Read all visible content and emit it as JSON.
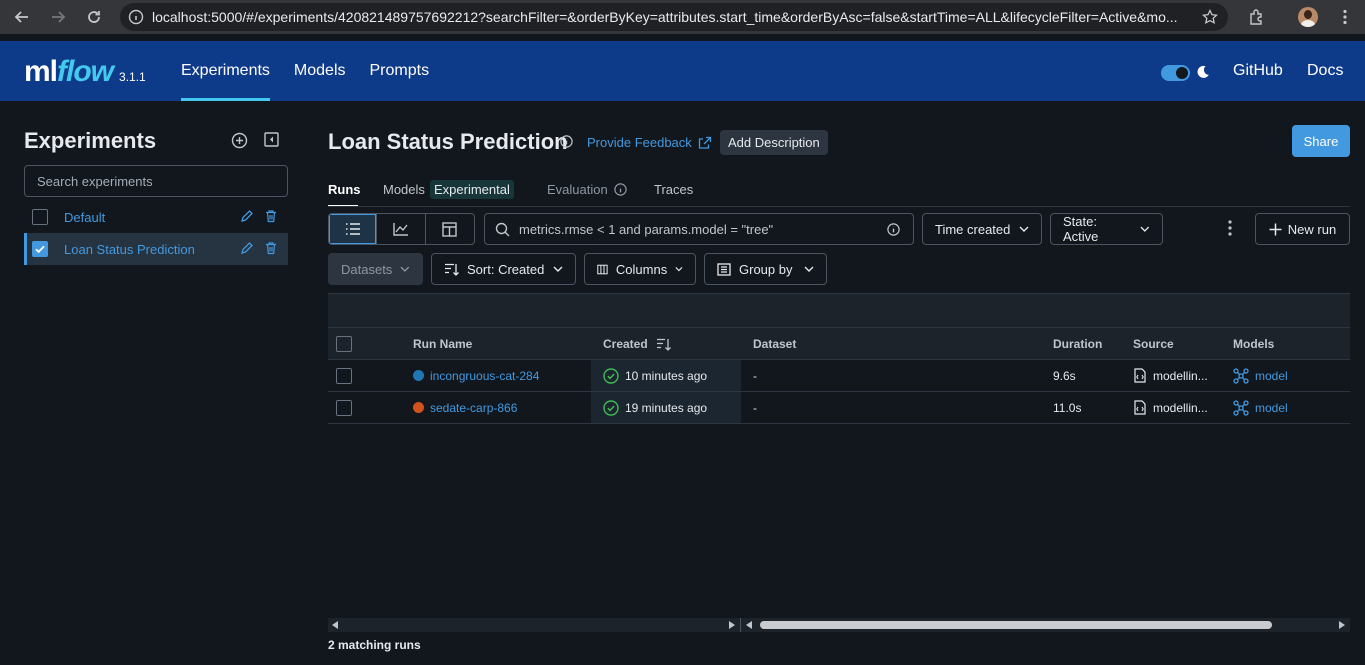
{
  "browser": {
    "url": "localhost:5000/#/experiments/420821489757692212?searchFilter=&orderByKey=attributes.start_time&orderByAsc=false&startTime=ALL&lifecycleFilter=Active&mo..."
  },
  "header": {
    "logo_ml": "ml",
    "logo_flow": "flow",
    "version": "3.1.1",
    "nav": [
      {
        "label": "Experiments",
        "active": true
      },
      {
        "label": "Models",
        "active": false
      },
      {
        "label": "Prompts",
        "active": false
      }
    ],
    "github_label": "GitHub",
    "docs_label": "Docs",
    "dark_mode": true
  },
  "sidebar": {
    "title": "Experiments",
    "search_placeholder": "Search experiments",
    "experiments": [
      {
        "name": "Default",
        "selected": false
      },
      {
        "name": "Loan Status Prediction",
        "selected": true
      }
    ]
  },
  "experiment": {
    "title": "Loan Status Prediction",
    "feedback_label": "Provide Feedback",
    "add_description_label": "Add Description",
    "share_label": "Share",
    "tabs": {
      "runs": "Runs",
      "models": "Models",
      "models_badge": "Experimental",
      "evaluation": "Evaluation",
      "traces": "Traces"
    }
  },
  "toolbar": {
    "search_value": "metrics.rmse < 1 and params.model = \"tree\"",
    "time_created": "Time created",
    "state": "State: Active",
    "new_run": "New run",
    "datasets": "Datasets",
    "sort": "Sort: Created",
    "columns": "Columns",
    "group_by": "Group by"
  },
  "table": {
    "columns": {
      "run_name": "Run Name",
      "created": "Created",
      "dataset": "Dataset",
      "duration": "Duration",
      "source": "Source",
      "models": "Models"
    },
    "rows": [
      {
        "name": "incongruous-cat-284",
        "color": "#1f77b4",
        "created": "10 minutes ago",
        "dataset": "-",
        "duration": "9.6s",
        "source": "modellin...",
        "model": "model"
      },
      {
        "name": "sedate-carp-866",
        "color": "#d1521e",
        "created": "19 minutes ago",
        "dataset": "-",
        "duration": "11.0s",
        "source": "modellin...",
        "model": "model"
      }
    ]
  },
  "footer": {
    "matching_runs": "2 matching runs"
  },
  "colors": {
    "accent": "#4299e0",
    "header_bg": "#0e3a8a",
    "success": "#3fb950"
  }
}
